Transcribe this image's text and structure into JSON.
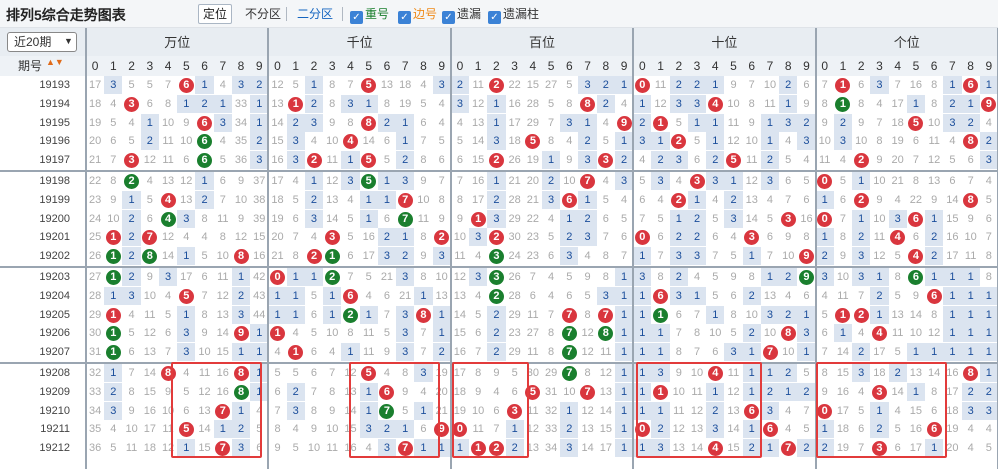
{
  "toolbar": {
    "title": "排列5综合走势图表",
    "buttons": [
      "定位",
      "不分区",
      "二分区"
    ],
    "checks": [
      {
        "label": "重号",
        "color": "#1a7f2e"
      },
      {
        "label": "边号",
        "color": "#ef8b1a"
      },
      {
        "label": "遗漏",
        "color": "#222"
      },
      {
        "label": "遗漏柱",
        "color": "#222"
      }
    ]
  },
  "controls": {
    "period_select": "近20期",
    "period_header": "期号"
  },
  "positions": [
    "万位",
    "千位",
    "百位",
    "十位",
    "个位"
  ],
  "digits": [
    "0",
    "1",
    "2",
    "3",
    "4",
    "5",
    "6",
    "7",
    "8",
    "9"
  ],
  "colors": {
    "hit": "#d9363e",
    "repeat": "#1a7f2e",
    "edge": "#ef8b1a",
    "miss": "#c23b3b",
    "bar": "#dbe4f0"
  },
  "periods": [
    "19193",
    "19194",
    "19195",
    "19196",
    "19197",
    "19198",
    "19199",
    "19200",
    "19201",
    "19202",
    "19203",
    "19204",
    "19205",
    "19206",
    "19207",
    "19208",
    "19209",
    "19210",
    "19211",
    "19212"
  ],
  "rows": [
    [
      [
        17,
        3,
        5,
        5,
        7,
        "6",
        1,
        4,
        3,
        2
      ],
      [
        12,
        5,
        1,
        8,
        7,
        "5",
        13,
        18,
        4,
        3
      ],
      [
        2,
        11,
        "2",
        22,
        15,
        27,
        5,
        3,
        2,
        1
      ],
      [
        "0",
        11,
        2,
        2,
        1,
        9,
        7,
        10,
        2,
        6
      ],
      [
        7,
        "1",
        6,
        3,
        7,
        16,
        8,
        1,
        "6",
        1
      ]
    ],
    [
      [
        18,
        4,
        "3",
        6,
        8,
        1,
        2,
        1,
        33,
        1
      ],
      [
        13,
        "1",
        2,
        8,
        3,
        1,
        8,
        19,
        5,
        4
      ],
      [
        3,
        12,
        1,
        16,
        28,
        5,
        8,
        "8",
        2,
        4
      ],
      [
        1,
        12,
        3,
        3,
        "4",
        10,
        8,
        11,
        1,
        9
      ],
      [
        8,
        "1",
        8,
        4,
        17,
        1,
        8,
        2,
        1,
        "9"
      ]
    ],
    [
      [
        19,
        5,
        4,
        1,
        10,
        9,
        "6",
        3,
        34,
        1
      ],
      [
        14,
        2,
        3,
        9,
        8,
        "8",
        2,
        1,
        6,
        4
      ],
      [
        4,
        13,
        1,
        17,
        29,
        7,
        3,
        1,
        4,
        "9"
      ],
      [
        2,
        "1",
        5,
        1,
        1,
        11,
        9,
        1,
        3,
        2
      ],
      [
        9,
        2,
        9,
        7,
        18,
        "5",
        10,
        3,
        2,
        4
      ]
    ],
    [
      [
        20,
        6,
        5,
        2,
        11,
        10,
        "6",
        4,
        35,
        2
      ],
      [
        15,
        3,
        4,
        10,
        "4",
        14,
        6,
        1,
        7,
        5
      ],
      [
        5,
        14,
        3,
        18,
        "5",
        8,
        4,
        2,
        5,
        1
      ],
      [
        3,
        1,
        "2",
        5,
        1,
        12,
        10,
        1,
        4,
        3
      ],
      [
        10,
        3,
        10,
        8,
        19,
        6,
        11,
        4,
        "8",
        2
      ]
    ],
    [
      [
        21,
        7,
        "3",
        12,
        11,
        6,
        "6",
        5,
        36,
        3
      ],
      [
        16,
        3,
        "2",
        11,
        1,
        "5",
        5,
        2,
        8,
        6
      ],
      [
        6,
        15,
        "2",
        26,
        19,
        1,
        9,
        3,
        "3",
        2
      ],
      [
        4,
        2,
        3,
        6,
        2,
        "5",
        11,
        2,
        5,
        4
      ],
      [
        11,
        4,
        "2",
        9,
        20,
        7,
        12,
        5,
        6,
        3
      ]
    ],
    [
      [
        22,
        8,
        "2",
        4,
        13,
        12,
        1,
        6,
        9,
        37
      ],
      [
        17,
        4,
        1,
        12,
        3,
        "5",
        1,
        3,
        9,
        7
      ],
      [
        7,
        16,
        1,
        21,
        20,
        2,
        10,
        "7",
        4,
        3
      ],
      [
        5,
        3,
        4,
        "3",
        3,
        1,
        12,
        3,
        6,
        5
      ],
      [
        "0",
        5,
        1,
        10,
        21,
        8,
        13,
        6,
        7,
        4
      ]
    ],
    [
      [
        23,
        9,
        1,
        5,
        "4",
        13,
        2,
        7,
        10,
        38
      ],
      [
        18,
        5,
        2,
        13,
        4,
        1,
        1,
        "7",
        10,
        8
      ],
      [
        8,
        17,
        2,
        28,
        21,
        3,
        "6",
        1,
        5,
        4
      ],
      [
        6,
        4,
        "2",
        1,
        4,
        2,
        13,
        4,
        7,
        6
      ],
      [
        1,
        6,
        "2",
        9,
        4,
        22,
        9,
        14,
        "8",
        5
      ]
    ],
    [
      [
        24,
        10,
        2,
        6,
        "4",
        3,
        8,
        11,
        9,
        39
      ],
      [
        19,
        6,
        3,
        14,
        5,
        1,
        6,
        "7",
        11,
        9
      ],
      [
        9,
        "1",
        3,
        29,
        22,
        4,
        1,
        2,
        6,
        5
      ],
      [
        7,
        5,
        1,
        2,
        5,
        3,
        14,
        5,
        "3",
        16
      ],
      [
        "0",
        7,
        1,
        10,
        3,
        "6",
        1,
        15,
        9,
        6
      ]
    ],
    [
      [
        25,
        "1",
        2,
        "7",
        12,
        4,
        4,
        8,
        12,
        15
      ],
      [
        20,
        7,
        4,
        "3",
        5,
        16,
        2,
        1,
        8,
        "2"
      ],
      [
        10,
        3,
        "2",
        30,
        23,
        5,
        2,
        3,
        7,
        6
      ],
      [
        "0",
        6,
        2,
        2,
        6,
        4,
        "3",
        6,
        9,
        8
      ],
      [
        1,
        8,
        2,
        11,
        "4",
        6,
        2,
        16,
        10,
        7
      ]
    ],
    [
      [
        26,
        "1",
        2,
        "8",
        14,
        1,
        5,
        10,
        "8",
        16
      ],
      [
        21,
        8,
        "2",
        "1",
        6,
        17,
        3,
        2,
        9,
        3
      ],
      [
        11,
        4,
        "3",
        24,
        23,
        6,
        3,
        4,
        8,
        7
      ],
      [
        1,
        7,
        3,
        3,
        7,
        5,
        1,
        7,
        10,
        "9"
      ],
      [
        2,
        9,
        3,
        12,
        5,
        "4",
        2,
        17,
        11,
        8
      ]
    ],
    [
      [
        27,
        "1",
        2,
        9,
        3,
        17,
        6,
        11,
        1,
        42
      ],
      [
        "0",
        1,
        1,
        "2",
        7,
        5,
        21,
        3,
        8,
        10
      ],
      [
        12,
        3,
        "3",
        26,
        7,
        4,
        5,
        9,
        8,
        1
      ],
      [
        3,
        8,
        2,
        4,
        5,
        9,
        8,
        1,
        2,
        "9"
      ],
      [
        3,
        10,
        3,
        1,
        8,
        "6",
        1,
        1,
        1,
        8
      ]
    ],
    [
      [
        28,
        1,
        3,
        10,
        4,
        "5",
        7,
        12,
        2,
        43
      ],
      [
        1,
        1,
        5,
        1,
        "6",
        4,
        6,
        21,
        1,
        13
      ],
      [
        13,
        4,
        "2",
        28,
        6,
        4,
        6,
        5,
        3,
        1
      ],
      [
        1,
        "6",
        3,
        1,
        5,
        6,
        2,
        13,
        4,
        6
      ],
      [
        4,
        11,
        7,
        2,
        5,
        9,
        "6",
        1,
        1,
        1
      ]
    ],
    [
      [
        29,
        "1",
        4,
        11,
        5,
        1,
        8,
        13,
        3,
        44
      ],
      [
        1,
        1,
        6,
        1,
        "2",
        1,
        7,
        3,
        "8",
        1
      ],
      [
        14,
        5,
        2,
        29,
        11,
        7,
        "7",
        8,
        "7",
        1
      ],
      [
        1,
        "1",
        6,
        7,
        1,
        8,
        10,
        3,
        2,
        1
      ],
      [
        5,
        "1",
        "2",
        1,
        13,
        14,
        8,
        1,
        1,
        1
      ]
    ],
    [
      [
        30,
        "1",
        5,
        12,
        6,
        3,
        9,
        14,
        "9",
        1
      ],
      [
        "1",
        4,
        5,
        10,
        8,
        11,
        5,
        3,
        7,
        1
      ],
      [
        15,
        6,
        2,
        23,
        27,
        8,
        "7",
        12,
        "8",
        1
      ],
      [
        1,
        1,
        7,
        8,
        10,
        5,
        2,
        10,
        "8",
        3
      ],
      [
        6,
        1,
        4,
        "4",
        11,
        10,
        12,
        1,
        1,
        1
      ]
    ],
    [
      [
        31,
        "1",
        6,
        13,
        7,
        3,
        10,
        15,
        1,
        1
      ],
      [
        4,
        "1",
        6,
        4,
        1,
        11,
        9,
        3,
        7,
        2
      ],
      [
        16,
        7,
        2,
        29,
        11,
        8,
        "7",
        12,
        11,
        1
      ],
      [
        1,
        1,
        8,
        7,
        6,
        3,
        1,
        "7",
        10,
        1
      ],
      [
        7,
        14,
        2,
        17,
        5,
        1,
        1,
        1,
        1,
        1
      ]
    ],
    [
      [
        32,
        1,
        7,
        14,
        "8",
        4,
        11,
        16,
        "8",
        1
      ],
      [
        5,
        5,
        6,
        7,
        12,
        "5",
        4,
        8,
        3,
        19
      ],
      [
        17,
        8,
        9,
        5,
        30,
        29,
        "7",
        8,
        12,
        1
      ],
      [
        1,
        3,
        9,
        10,
        "4",
        11,
        1,
        1,
        2,
        5
      ],
      [
        8,
        15,
        3,
        18,
        2,
        13,
        14,
        16,
        "8",
        1
      ]
    ],
    [
      [
        33,
        2,
        8,
        15,
        9,
        5,
        12,
        16,
        "8",
        1
      ],
      [
        6,
        2,
        7,
        8,
        13,
        1,
        "6",
        9,
        4,
        20
      ],
      [
        18,
        9,
        4,
        6,
        "5",
        31,
        10,
        "7",
        13,
        1
      ],
      [
        1,
        "1",
        10,
        11,
        1,
        12,
        1,
        2,
        1,
        2
      ],
      [
        9,
        16,
        4,
        "3",
        14,
        1,
        8,
        17,
        2,
        2
      ]
    ],
    [
      [
        34,
        3,
        9,
        16,
        10,
        6,
        13,
        "7",
        1,
        4
      ],
      [
        7,
        3,
        8,
        9,
        14,
        1,
        "7",
        5,
        1,
        21
      ],
      [
        19,
        10,
        6,
        "3",
        11,
        32,
        1,
        12,
        14,
        1
      ],
      [
        1,
        1,
        11,
        12,
        2,
        13,
        "6",
        3,
        4,
        7
      ],
      [
        "0",
        17,
        5,
        1,
        4,
        15,
        6,
        18,
        3,
        3
      ]
    ],
    [
      [
        35,
        4,
        10,
        17,
        11,
        "5",
        14,
        1,
        2,
        5
      ],
      [
        8,
        4,
        9,
        10,
        15,
        3,
        2,
        1,
        6,
        "9"
      ],
      [
        "0",
        11,
        7,
        1,
        12,
        33,
        2,
        13,
        15,
        1
      ],
      [
        "0",
        2,
        12,
        13,
        3,
        14,
        1,
        "6",
        4,
        5
      ],
      [
        1,
        18,
        6,
        2,
        5,
        16,
        "6",
        19,
        4,
        4
      ]
    ],
    [
      [
        36,
        5,
        11,
        18,
        12,
        1,
        15,
        "7",
        3,
        6
      ],
      [
        9,
        5,
        10,
        11,
        16,
        4,
        3,
        "7",
        1,
        1
      ],
      [
        1,
        "1",
        "2",
        2,
        13,
        34,
        3,
        14,
        17,
        1
      ],
      [
        1,
        3,
        13,
        14,
        "4",
        15,
        2,
        1,
        "7",
        2
      ],
      [
        2,
        19,
        7,
        "3",
        6,
        17,
        1,
        20,
        4,
        5
      ]
    ]
  ]
}
